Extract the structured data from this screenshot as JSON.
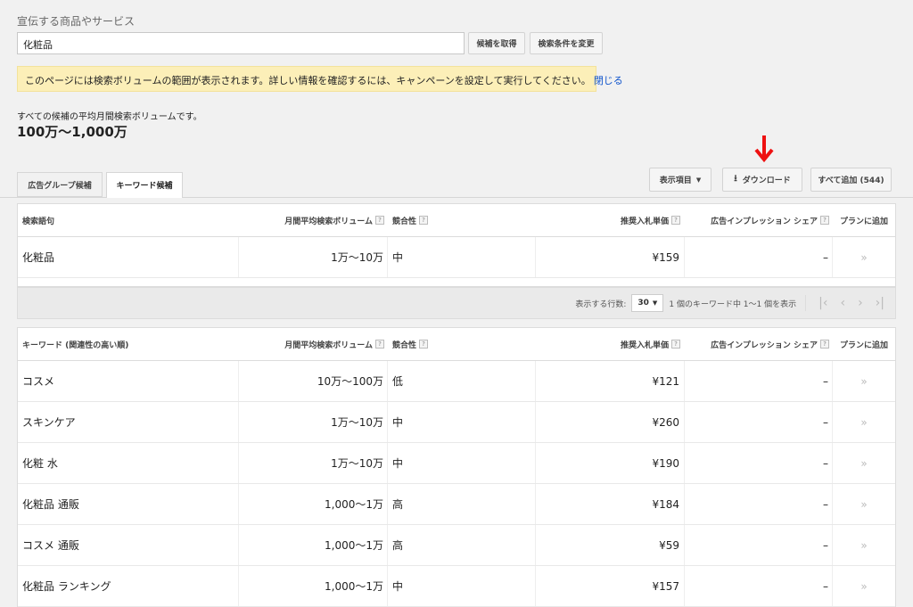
{
  "search": {
    "label": "宣伝する商品やサービス",
    "value": "化粧品",
    "get_ideas_btn": "候補を取得",
    "modify_search_btn": "検索条件を変更"
  },
  "notice": {
    "text": "このページには検索ボリュームの範囲が表示されます。詳しい情報を確認するには、キャンペーンを設定して実行してください。",
    "close_link": "閉じる"
  },
  "average": {
    "label": "すべての候補の平均月間検索ボリュームです。",
    "value": "100万〜1,000万"
  },
  "tabs": [
    {
      "label": "広告グループ候補",
      "active": false
    },
    {
      "label": "キーワード候補",
      "active": true
    }
  ],
  "toolbar": {
    "columns_btn": "表示項目",
    "download_btn": "ダウンロード",
    "add_all_btn": "すべて追加 (544)"
  },
  "arrow_color": "#ee1111",
  "search_terms_table": {
    "headers": [
      "検索語句",
      "月間平均検索ボリューム",
      "競合性",
      "推奨入札単価",
      "広告インプレッション シェア",
      "プランに追加"
    ],
    "rows": [
      {
        "keyword": "化粧品",
        "volume": "1万〜10万",
        "competition": "中",
        "bid": "¥159",
        "share": "–",
        "add": "»"
      }
    ]
  },
  "pager": {
    "rows_label": "表示する行数:",
    "rows_value": "30",
    "range_text": "1 個のキーワード中 1〜1 個を表示"
  },
  "ideas_table": {
    "headers": [
      "キーワード (関連性の高い順)",
      "月間平均検索ボリューム",
      "競合性",
      "推奨入札単価",
      "広告インプレッション シェア",
      "プランに追加"
    ],
    "rows": [
      {
        "keyword": "コスメ",
        "volume": "10万〜100万",
        "competition": "低",
        "bid": "¥121",
        "share": "–",
        "add": "»"
      },
      {
        "keyword": "スキンケア",
        "volume": "1万〜10万",
        "competition": "中",
        "bid": "¥260",
        "share": "–",
        "add": "»"
      },
      {
        "keyword": "化粧 水",
        "volume": "1万〜10万",
        "competition": "中",
        "bid": "¥190",
        "share": "–",
        "add": "»"
      },
      {
        "keyword": "化粧品 通販",
        "volume": "1,000〜1万",
        "competition": "高",
        "bid": "¥184",
        "share": "–",
        "add": "»"
      },
      {
        "keyword": "コスメ 通販",
        "volume": "1,000〜1万",
        "competition": "高",
        "bid": "¥59",
        "share": "–",
        "add": "»"
      },
      {
        "keyword": "化粧品 ランキング",
        "volume": "1,000〜1万",
        "competition": "中",
        "bid": "¥157",
        "share": "–",
        "add": "»"
      }
    ]
  }
}
